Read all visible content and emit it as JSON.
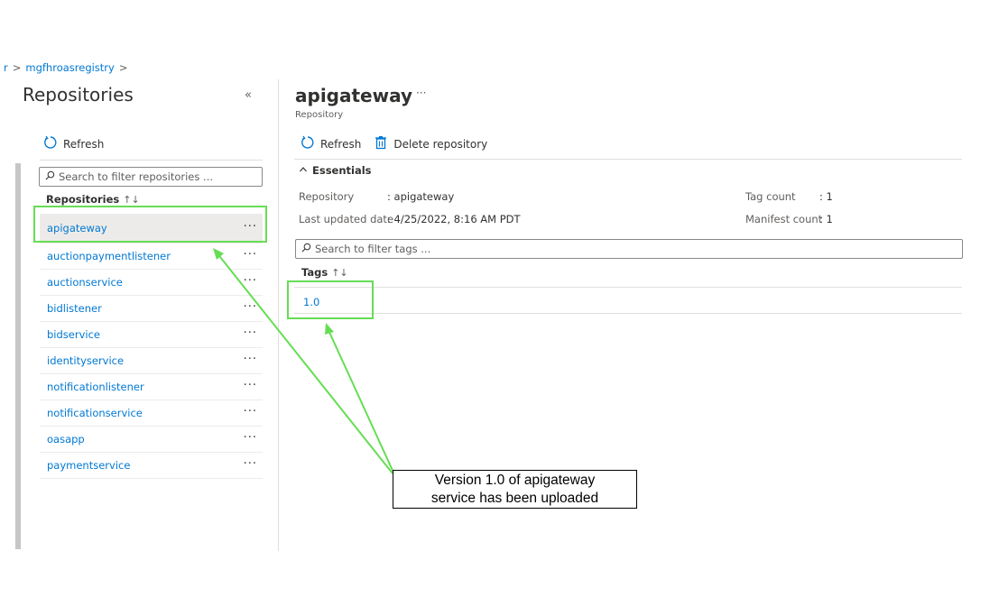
{
  "breadcrumb": {
    "items": [
      "r",
      "mgfhroasregistry"
    ],
    "separator": ">"
  },
  "left_panel": {
    "title": "Repositories",
    "collapse_glyph": "«",
    "refresh_label": "Refresh",
    "search_placeholder": "Search to filter repositories ...",
    "column_header": "Repositories",
    "sort_glyph": "↑↓",
    "repositories": [
      "apigateway",
      "auctionpaymentlistener",
      "auctionservice",
      "bidlistener",
      "bidservice",
      "identityservice",
      "notificationlistener",
      "notificationservice",
      "oasapp",
      "paymentservice"
    ],
    "selected_repository": "apigateway",
    "row_more_glyph": "···"
  },
  "detail": {
    "title": "apigateway",
    "title_more": "···",
    "subtitle": "Repository",
    "toolbar": {
      "refresh_label": "Refresh",
      "delete_label": "Delete repository"
    },
    "essentials_label": "Essentials",
    "essentials": {
      "repository_label": "Repository",
      "repository_value": ": apigateway",
      "last_updated_label": "Last updated date",
      "last_updated_value": ": 4/25/2022, 8:16 AM PDT",
      "tag_count_label": "Tag count",
      "tag_count_value": ": 1",
      "manifest_count_label": "Manifest count",
      "manifest_count_value": ": 1"
    },
    "tags_search_placeholder": "Search to filter tags ...",
    "tags_header": "Tags",
    "sort_glyph": "↑↓",
    "tags": [
      "1.0"
    ]
  },
  "annotation": {
    "line1": "Version 1.0 of apigateway",
    "line2": "service has been uploaded",
    "highlight_color": "#66dd55"
  },
  "colors": {
    "link": "#0078d4",
    "text": "#323130",
    "muted": "#605e5c",
    "accent_highlight": "#66dd55"
  },
  "icons": {
    "refresh": "refresh-icon",
    "delete": "trash-icon",
    "search": "search-icon",
    "collapse": "double-chevron-left-icon",
    "essentials": "chevron-up-icon"
  }
}
